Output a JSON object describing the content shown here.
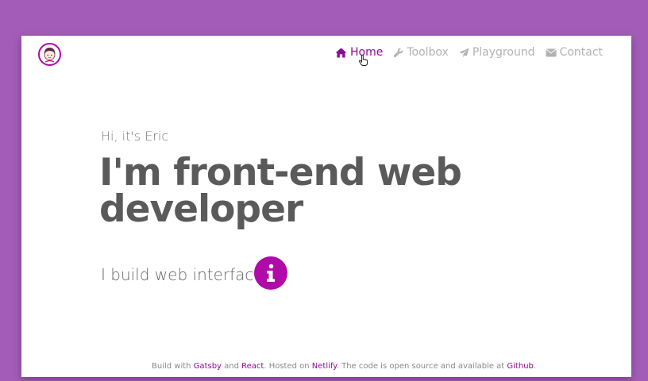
{
  "colors": {
    "page_background": "#a35db8",
    "card_background": "#ffffff",
    "accent": "#b00aa8",
    "nav_active": "#8e0a96",
    "nav_inactive": "#b2b2b2",
    "text_dark": "#5a5a5a"
  },
  "header": {
    "logo_icon": "avatar-logo",
    "nav": [
      {
        "label": "Home",
        "icon": "home-icon",
        "active": true
      },
      {
        "label": "Toolbox",
        "icon": "wrench-icon",
        "active": false
      },
      {
        "label": "Playground",
        "icon": "paper-plane-icon",
        "active": false
      },
      {
        "label": "Contact",
        "icon": "envelope-icon",
        "active": false
      }
    ]
  },
  "hero": {
    "greeting": "Hi, it's Eric",
    "headline": "I'm front-end web developer",
    "tagline": "I build web interfaces",
    "info_icon": "info-icon"
  },
  "footer": {
    "t1": "Build with ",
    "gatsby": "Gatsby",
    "t2": " and ",
    "react": "React",
    "t3": ". Hosted on ",
    "netlify": "Netlify",
    "t4": ". The code is open source and available at ",
    "github": "Github",
    "t5": "."
  }
}
